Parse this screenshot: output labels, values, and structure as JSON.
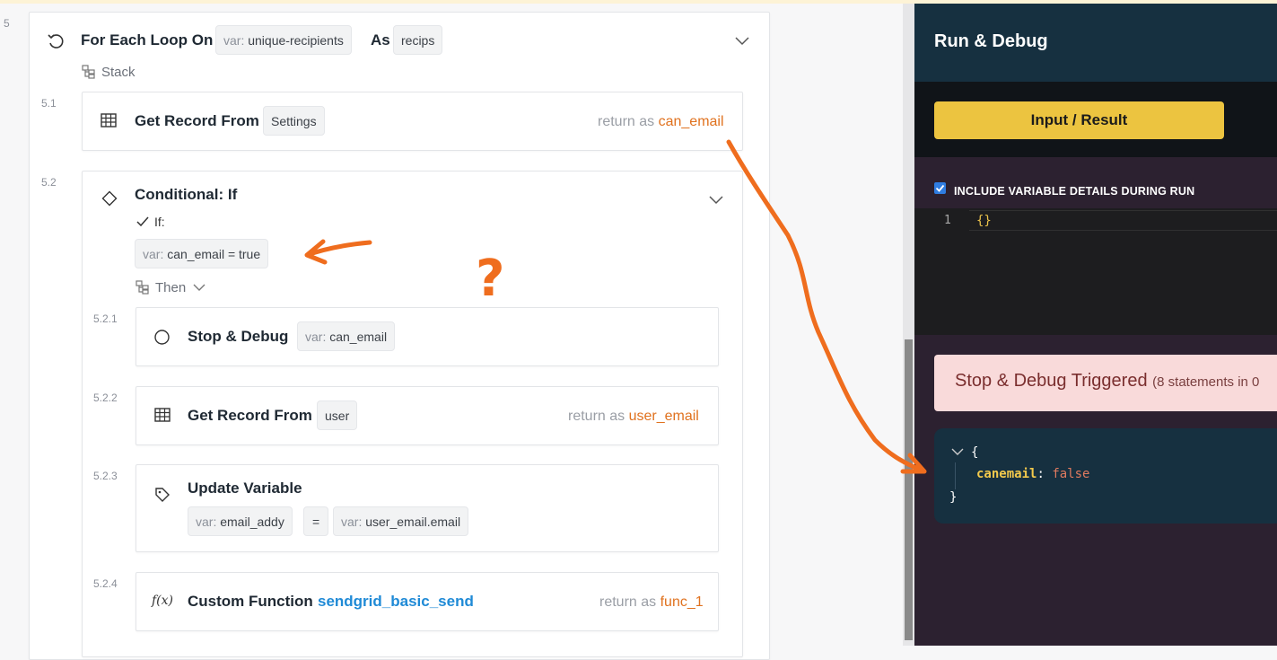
{
  "loop": {
    "step": "5",
    "title": "For Each Loop On",
    "source_prefix": "var:",
    "source": "unique-recipients",
    "as_label": "As",
    "as_value": "recips",
    "stack_label": "Stack"
  },
  "step51": {
    "num": "5.1",
    "title": "Get Record From",
    "table": "Settings",
    "return_label": "return as",
    "return_var": "can_email"
  },
  "step52": {
    "num": "5.2",
    "title": "Conditional: If",
    "if_label": "If:",
    "cond_prefix": "var:",
    "cond": "can_email = true",
    "then_label": "Then"
  },
  "step521": {
    "num": "5.2.1",
    "title": "Stop & Debug",
    "var_prefix": "var:",
    "var": "can_email"
  },
  "step522": {
    "num": "5.2.2",
    "title": "Get Record From",
    "table": "user",
    "return_label": "return as",
    "return_var": "user_email"
  },
  "step523": {
    "num": "5.2.3",
    "title": "Update Variable",
    "left_prefix": "var:",
    "left": "email_addy",
    "op": "=",
    "right_prefix": "var:",
    "right": "user_email.email"
  },
  "step524": {
    "num": "5.2.4",
    "icon_text": "f(x)",
    "title": "Custom Function",
    "func": "sendgrid_basic_send",
    "return_label": "return as",
    "return_var": "func_1"
  },
  "annotation": {
    "question": "?"
  },
  "panel": {
    "title": "Run & Debug",
    "button": "Input / Result",
    "include_vars": "INCLUDE VARIABLE DETAILS DURING RUN",
    "include_vars_checked": true,
    "editor_line": "1",
    "editor_code": "{}",
    "alert_title": "Stop & Debug Triggered",
    "alert_detail": "(8 statements in 0",
    "json_open": "{",
    "json_key": "canemail",
    "json_sep": ":",
    "json_value": "false",
    "json_close": "}"
  },
  "colors": {
    "accent_orange": "#e0721f",
    "link_blue": "#1f8ad6",
    "panel_navy": "#163040",
    "button_yellow": "#ecc440",
    "annotation_orange": "#ef6d1e"
  }
}
